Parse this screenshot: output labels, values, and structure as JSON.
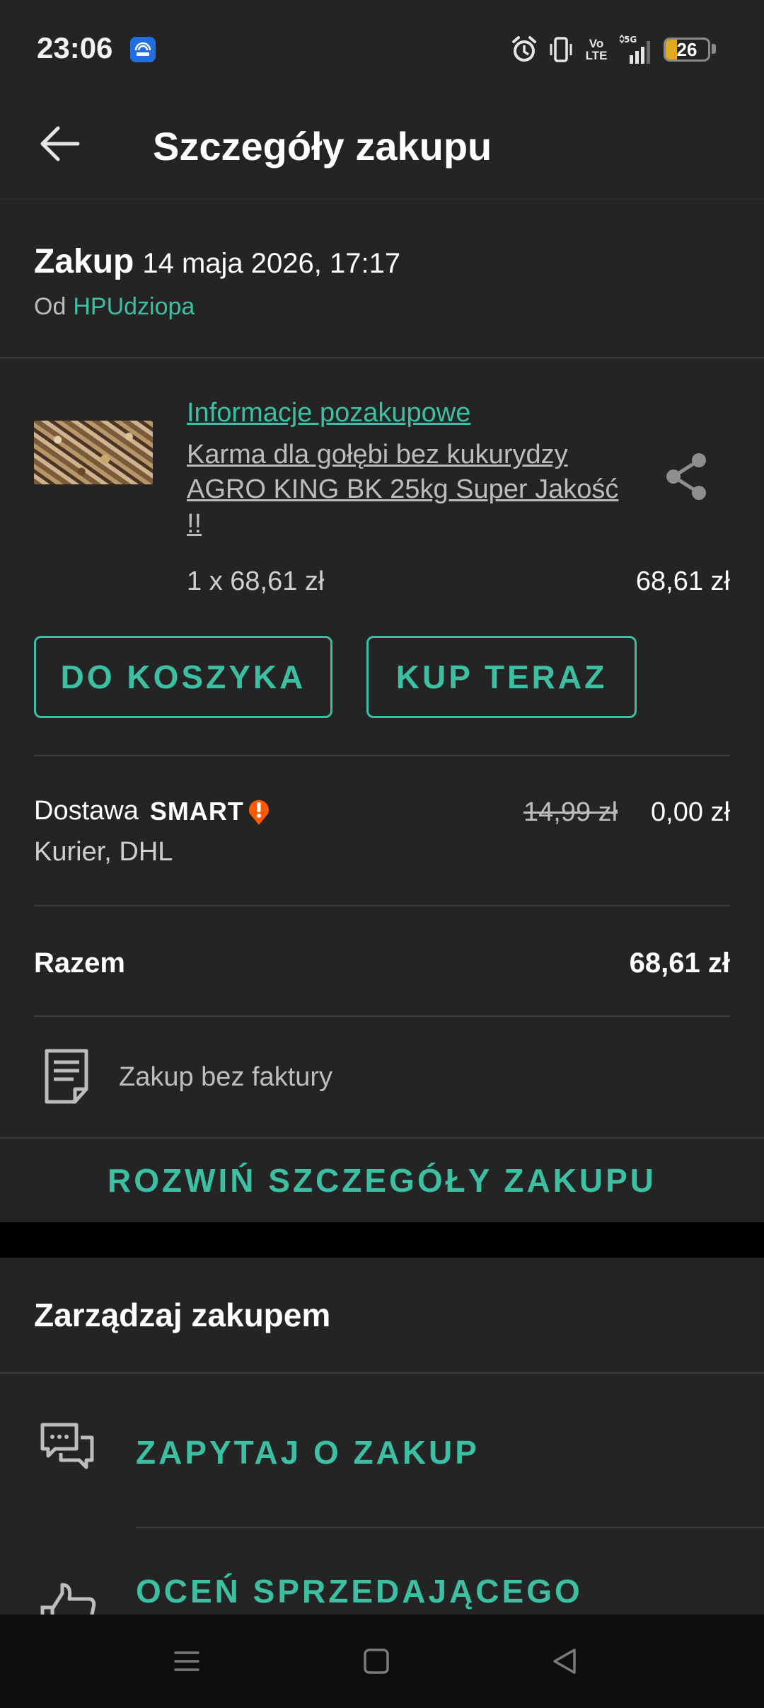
{
  "status_bar": {
    "time": "23:06",
    "network_type": "5G",
    "volte": "Vo LTE",
    "battery_level": "26",
    "battery_fraction": 0.26,
    "icons": [
      "app-notification-icon",
      "alarm-icon",
      "vibrate-icon",
      "volte-icon",
      "signal-icon",
      "battery-icon"
    ]
  },
  "toolbar": {
    "title": "Szczegóły zakupu"
  },
  "purchase": {
    "label": "Zakup",
    "date": "14 maja 2026, 17:17",
    "seller_prefix": "Od",
    "seller": "HPUdziopa"
  },
  "item": {
    "info_link": "Informacje pozakupowe",
    "title": "Karma dla gołębi bez kukurydzy AGRO KING BK 25kg Super Jakość !!",
    "quantity_price": "1 x 68,61 zł",
    "total": "68,61 zł"
  },
  "buttons": {
    "cart": "DO KOSZYKA",
    "buy_now": "KUP TERAZ",
    "expand": "ROZWIŃ SZCZEGÓŁY ZAKUPU"
  },
  "delivery": {
    "label": "Dostawa",
    "smart": "SMART",
    "carrier": "Kurier, DHL",
    "old_price": "14,99 zł",
    "price": "0,00 zł"
  },
  "summary": {
    "label": "Razem",
    "value": "68,61 zł"
  },
  "invoice": {
    "text": "Zakup bez faktury"
  },
  "manage": {
    "title": "Zarządzaj zakupem",
    "actions": [
      {
        "label": "ZAPYTAJ O ZAKUP",
        "icon": "chat-icon"
      },
      {
        "label": "OCEŃ SPRZEDAJĄCEGO",
        "icon": "thumbs-up-icon"
      }
    ]
  },
  "colors": {
    "accent": "#3cbfa3",
    "background": "#242424",
    "smart_orange": "#ff5a00"
  }
}
